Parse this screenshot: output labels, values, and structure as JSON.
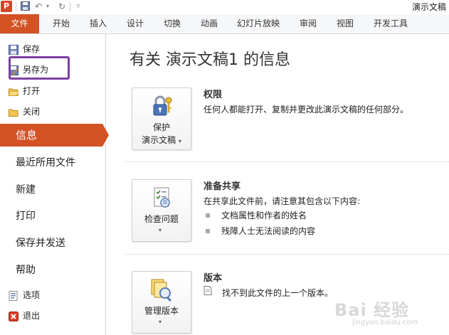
{
  "window": {
    "title": "演示文稿"
  },
  "app_icon_letter": "P",
  "ribbon": {
    "tabs": [
      "文件",
      "开始",
      "插入",
      "设计",
      "切换",
      "动画",
      "幻灯片放映",
      "审阅",
      "视图",
      "开发工具"
    ]
  },
  "sidebar": {
    "save": "保存",
    "save_as": "另存为",
    "open": "打开",
    "close": "关闭",
    "info": "信息",
    "recent": "最近所用文件",
    "new": "新建",
    "print": "打印",
    "save_send": "保存并发送",
    "help": "帮助",
    "options": "选项",
    "exit": "退出"
  },
  "main": {
    "title": "有关 演示文稿1 的信息",
    "permissions": {
      "button_line1": "保护",
      "button_line2": "演示文稿",
      "title": "权限",
      "desc": "任何人都能打开、复制并更改此演示文稿的任何部分。"
    },
    "prepare": {
      "button_label": "检查问题",
      "title": "准备共享",
      "desc": "在共享此文件前，请注意其包含以下内容:",
      "items": [
        "文档属性和作者的姓名",
        "残障人士无法阅读的内容"
      ]
    },
    "versions": {
      "button_label": "管理版本",
      "title": "版本",
      "desc": "找不到此文件的上一个版本。"
    }
  },
  "watermark": {
    "main": "Bai 经验",
    "sub": "jingyan.baidu.com"
  },
  "colors": {
    "accent": "#d35224",
    "highlight": "#7d3fa2"
  }
}
